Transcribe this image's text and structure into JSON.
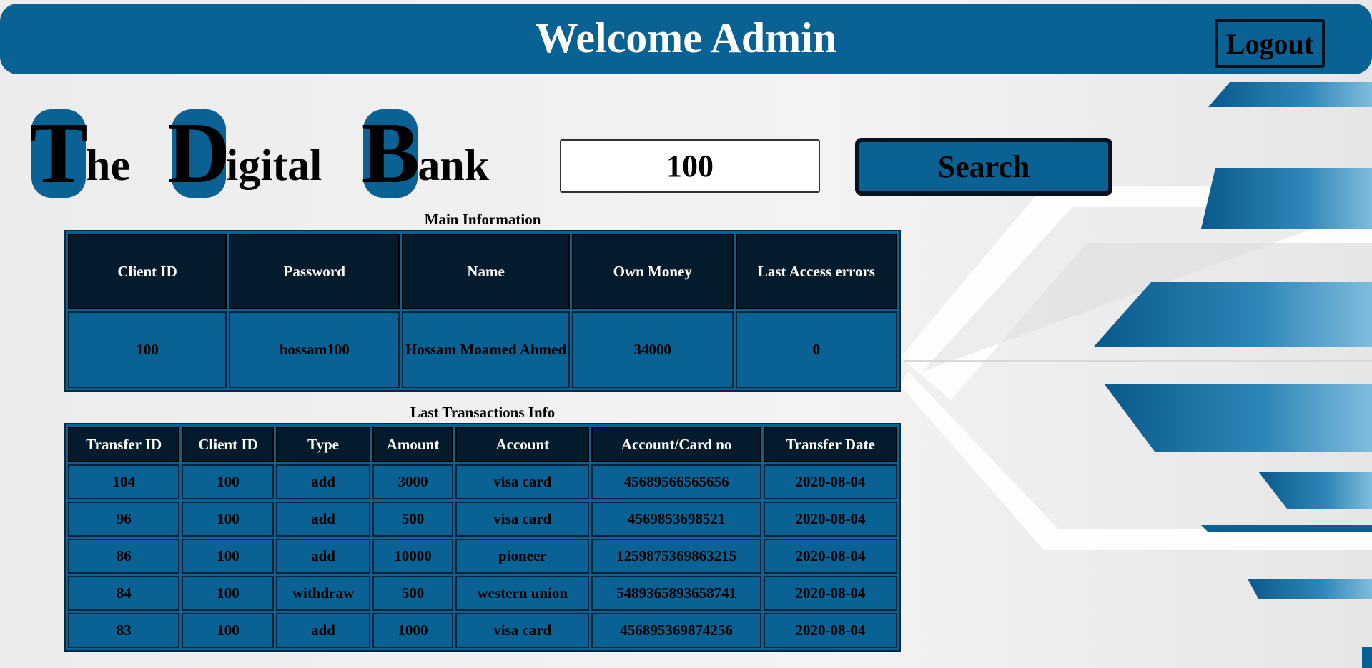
{
  "header": {
    "title": "Welcome Admin",
    "logout_label": "Logout"
  },
  "brand": {
    "words": [
      {
        "cap": "T",
        "rest": "he"
      },
      {
        "cap": "D",
        "rest": "igital"
      },
      {
        "cap": "B",
        "rest": "ank"
      }
    ]
  },
  "search": {
    "value": "100",
    "button_label": "Search"
  },
  "main_info": {
    "caption": "Main Information",
    "headers": [
      "Client ID",
      "Password",
      "Name",
      "Own Money",
      "Last Access errors"
    ],
    "row": [
      "100",
      "hossam100",
      "Hossam Moamed Ahmed",
      "34000",
      "0"
    ]
  },
  "transactions": {
    "caption": "Last Transactions Info",
    "headers": [
      "Transfer ID",
      "Client ID",
      "Type",
      "Amount",
      "Account",
      "Account/Card no",
      "Transfer Date"
    ],
    "rows": [
      [
        "104",
        "100",
        "add",
        "3000",
        "visa card",
        "45689566565656",
        "2020-08-04"
      ],
      [
        "96",
        "100",
        "add",
        "500",
        "visa card",
        "4569853698521",
        "2020-08-04"
      ],
      [
        "86",
        "100",
        "add",
        "10000",
        "pioneer",
        "1259875369863215",
        "2020-08-04"
      ],
      [
        "84",
        "100",
        "withdraw",
        "500",
        "western union",
        "5489365893658741",
        "2020-08-04"
      ],
      [
        "83",
        "100",
        "add",
        "1000",
        "visa card",
        "456895369874256",
        "2020-08-04"
      ]
    ]
  },
  "colors": {
    "primary": "#0a6193",
    "header_cell": "#031b2b",
    "background": "#ececec"
  }
}
